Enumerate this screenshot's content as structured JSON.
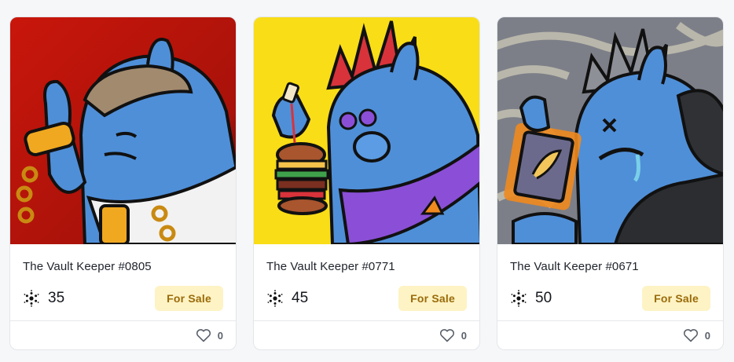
{
  "cards": [
    {
      "name": "The Vault Keeper #0805",
      "price": "35",
      "status": "For Sale",
      "likes": "0",
      "art": {
        "background": "#c4170f",
        "accent": "#f0a820",
        "hat": "#a28a6e",
        "body": "#4f8fd8"
      }
    },
    {
      "name": "The Vault Keeper #0771",
      "price": "45",
      "status": "For Sale",
      "likes": "0",
      "art": {
        "background": "#f9dd17",
        "accent": "#8a4fd6",
        "hat": "#d8333a",
        "body": "#4f8fd8"
      }
    },
    {
      "name": "The Vault Keeper #0671",
      "price": "50",
      "status": "For Sale",
      "likes": "0",
      "art": {
        "background": "#8a8c94",
        "accent": "#f08a1e",
        "hat": "#5b5e66",
        "body": "#4f8fd8"
      }
    }
  ],
  "icons": {
    "currency": "cardano-icon",
    "like": "heart-outline-icon"
  }
}
